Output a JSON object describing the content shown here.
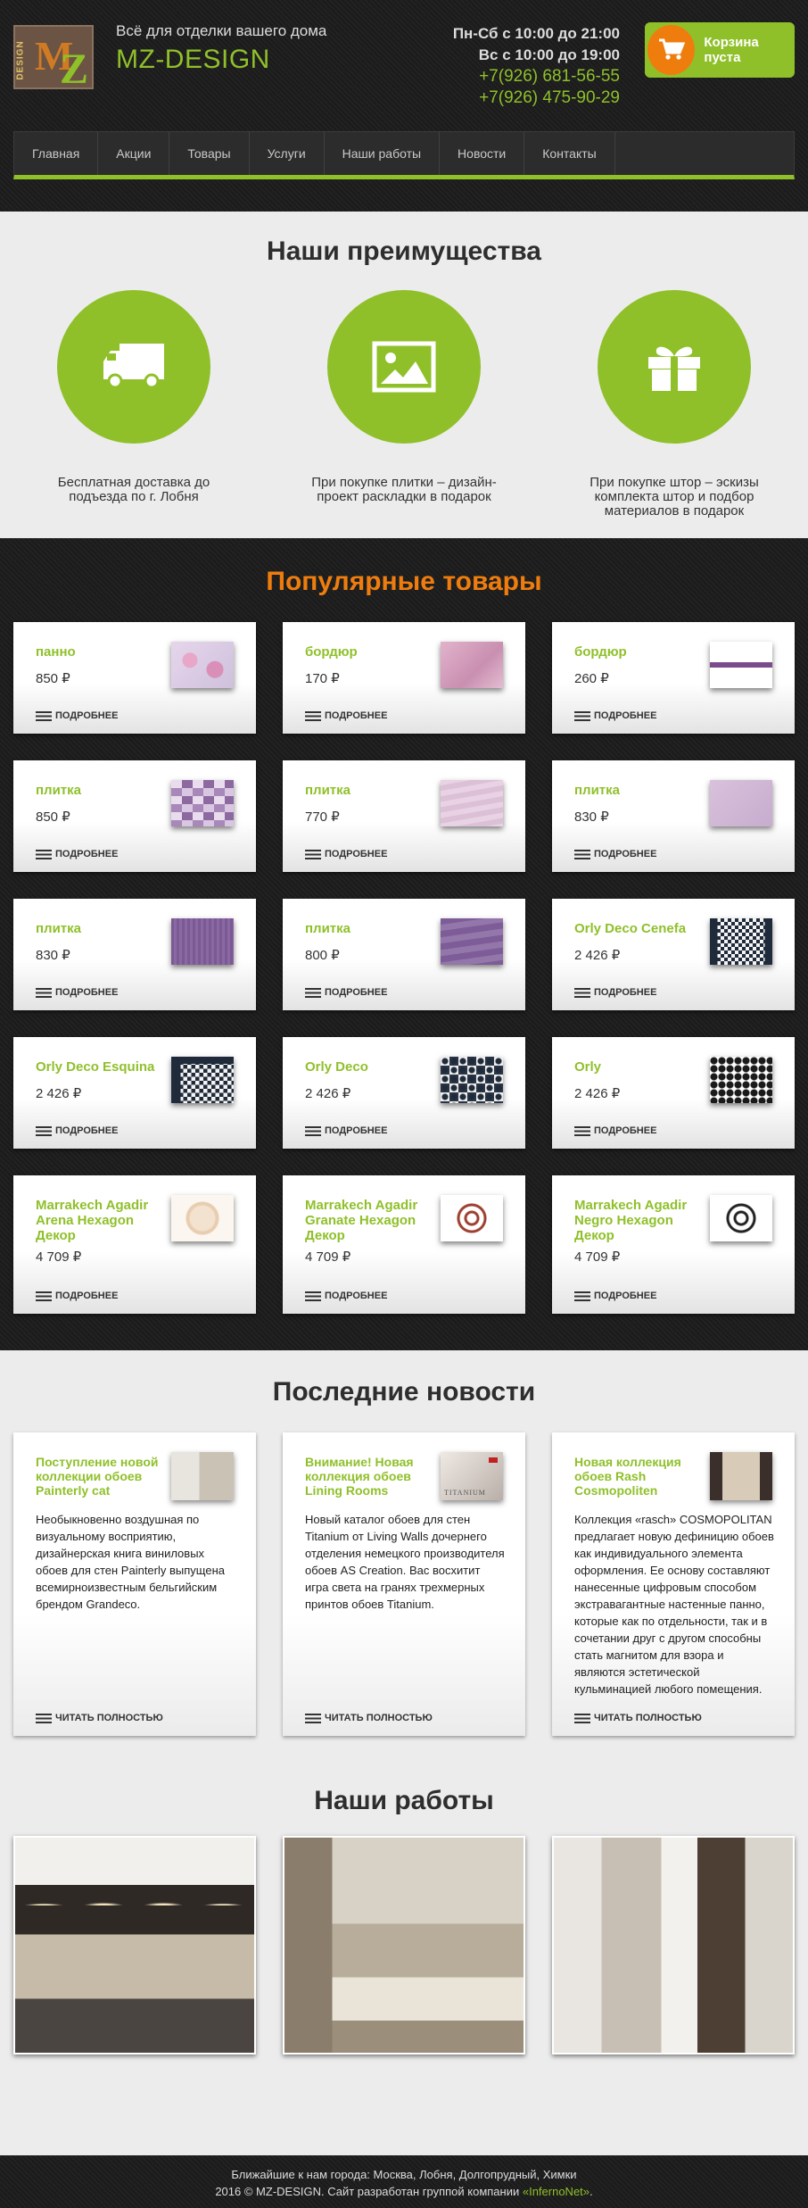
{
  "header": {
    "tagline": "Всё для отделки вашего дома",
    "brand": "MZ-DESIGN",
    "logo_text": "MZ",
    "logo_vertical": "DESIGN",
    "hours": [
      "Пн-Сб с 10:00 до 21:00",
      "Вс с 10:00 до 19:00"
    ],
    "phones": [
      "+7(926) 681-56-55",
      "+7(926) 475-90-29"
    ],
    "cart_label": "Корзина пуста",
    "accent": "#8fc02a",
    "orange": "#ef7d0e"
  },
  "nav": [
    "Главная",
    "Акции",
    "Товары",
    "Услуги",
    "Наши работы",
    "Новости",
    "Контакты"
  ],
  "advantages": {
    "title": "Наши преимущества",
    "items": [
      {
        "icon": "truck-icon",
        "text": "Бесплатная доставка до подъезда по г. Лобня"
      },
      {
        "icon": "image-icon",
        "text": "При покупке плитки – дизайн-проект раскладки в подарок"
      },
      {
        "icon": "gift-icon",
        "text": "При покупке штор – эскизы комплекта штор и подбор материалов в подарок"
      }
    ]
  },
  "popular": {
    "title": "Популярные товары",
    "more_label": "ПОДРОБНЕЕ",
    "products": [
      {
        "name": "панно",
        "price": "850 ₽"
      },
      {
        "name": "бордюр",
        "price": "170 ₽"
      },
      {
        "name": "бордюр",
        "price": "260 ₽"
      },
      {
        "name": "плитка",
        "price": "850 ₽"
      },
      {
        "name": "плитка",
        "price": "770 ₽"
      },
      {
        "name": "плитка",
        "price": "830 ₽"
      },
      {
        "name": "плитка",
        "price": "830 ₽"
      },
      {
        "name": "плитка",
        "price": "800 ₽"
      },
      {
        "name": "Orly Deco Cenefa",
        "price": "2 426 ₽"
      },
      {
        "name": "Orly Deco Esquina",
        "price": "2 426 ₽"
      },
      {
        "name": "Orly Deco",
        "price": "2 426 ₽"
      },
      {
        "name": "Orly",
        "price": "2 426 ₽"
      },
      {
        "name": "Marrakech Agadir Arena Hexagon Декор",
        "price": "4 709 ₽"
      },
      {
        "name": "Marrakech Agadir Granate Hexagon Декор",
        "price": "4 709 ₽"
      },
      {
        "name": "Marrakech Agadir Negro Hexagon Декор",
        "price": "4 709 ₽"
      }
    ]
  },
  "news": {
    "title": "Последние новости",
    "more_label": "ЧИТАТЬ ПОЛНОСТЬЮ",
    "items": [
      {
        "title": "Поступление новой коллекции обоев Painterly cat",
        "body": "Необыкновенно воздушная по визуальному восприятию, дизайнерская книга виниловых обоев для стен Painterly выпущена всемирноизвестным бельгийским брендом Grandeco."
      },
      {
        "title": "Внимание! Новая коллекция обоев Lining Rooms",
        "body": "Новый каталог обоев для стен Titanium от Living Walls дочернего отделения немецкого производителя обоев AS Creation. Вас восхитит игра света на гранях трехмерных принтов обоев Titanium.",
        "thumb_text": "TITANIUM"
      },
      {
        "title": "Новая коллекция обоев Rash Cosmopoliten",
        "body": "Коллекция «rasch» COSMOPOLITAN предлагает новую дефиницию обоев как индивидуального элемента оформления. Ее основу составляют нанесенные цифровым способом экстравагантные настенные панно, которые как по отдельности, так и в сочетании друг с другом способны стать магнитом для взора и являются эстетической кульминацией любого помещения."
      }
    ]
  },
  "works": {
    "title": "Наши работы"
  },
  "footer": {
    "cities": "Ближайшие к нам города: Москва, Лобня, Долгопрудный, Химки",
    "copyright": "2016 © MZ-DESIGN. Сайт разработан группой компании ",
    "company": "«InfernoNet»",
    "period": "."
  }
}
